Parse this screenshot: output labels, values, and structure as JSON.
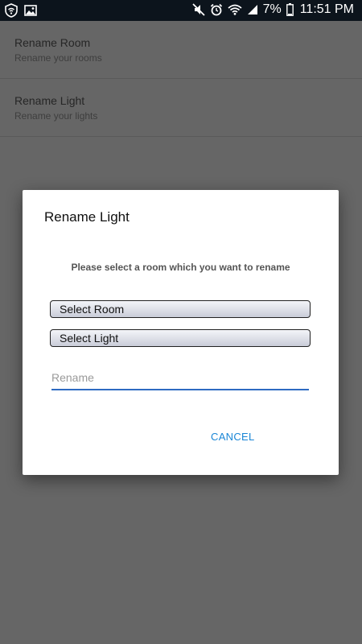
{
  "status_bar": {
    "battery_percent": "7%",
    "time": "11:51 PM",
    "left_icons": [
      "shield-wifi-icon",
      "image-icon"
    ],
    "right_icons": [
      "mute-icon",
      "alarm-icon",
      "wifi-icon",
      "signal-icon",
      "battery-icon"
    ]
  },
  "list": {
    "items": [
      {
        "title": "Rename Room",
        "subtitle": "Rename your rooms"
      },
      {
        "title": "Rename Light",
        "subtitle": "Rename your lights"
      }
    ]
  },
  "dialog": {
    "title": "Rename Light",
    "message": "Please select a room which you want to rename",
    "select_room": "Select Room",
    "select_light": "Select Light",
    "rename_placeholder": "Rename",
    "rename_value": "",
    "cancel_label": "CANCEL",
    "accent_color": "#1a86d6"
  }
}
